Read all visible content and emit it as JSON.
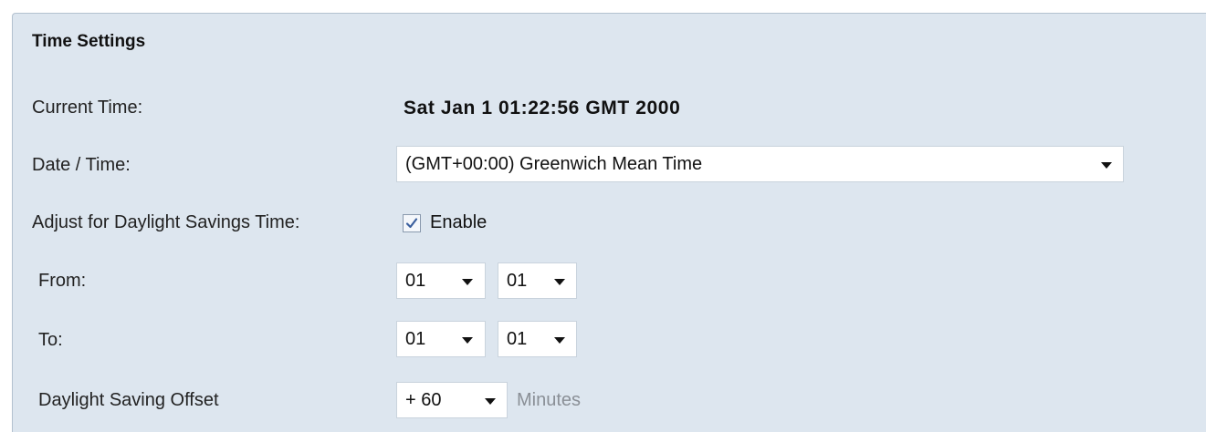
{
  "section": {
    "title": "Time Settings"
  },
  "current_time": {
    "label": "Current Time:",
    "value": "Sat Jan 1 01:22:56 GMT 2000"
  },
  "date_time": {
    "label": "Date / Time:",
    "selected": "(GMT+00:00) Greenwich Mean Time"
  },
  "dst": {
    "label": "Adjust for Daylight Savings Time:",
    "enable_label": "Enable",
    "enabled": true
  },
  "from": {
    "label": "From:",
    "month": "01",
    "day": "01"
  },
  "to": {
    "label": "To:",
    "month": "01",
    "day": "01"
  },
  "offset": {
    "label": "Daylight Saving Offset",
    "selected": "+ 60",
    "unit": "Minutes"
  }
}
